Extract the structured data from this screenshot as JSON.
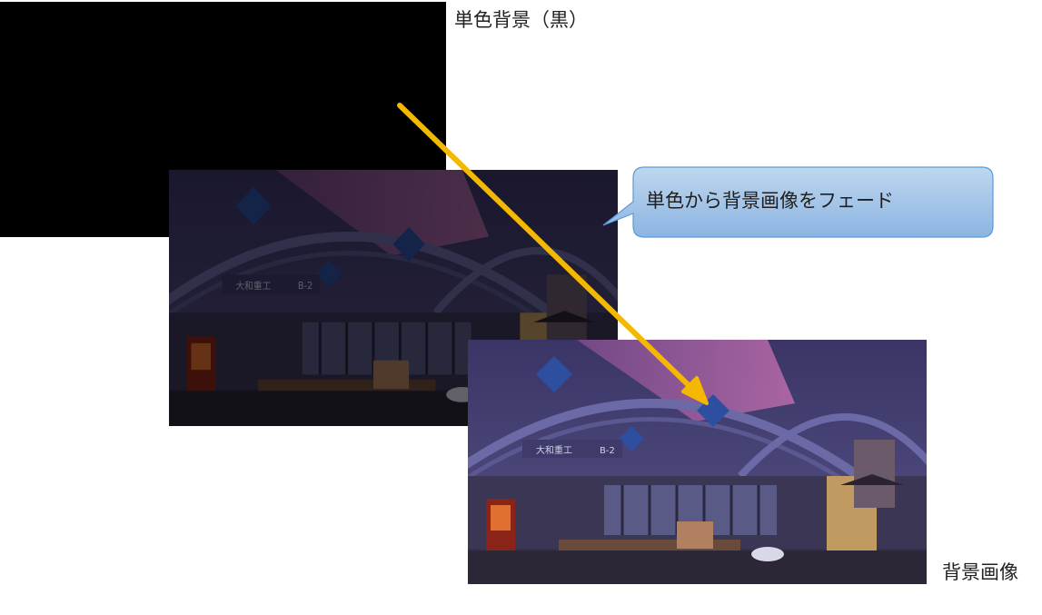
{
  "labels": {
    "solid_background": "単色背景（黒）",
    "background_image": "背景画像"
  },
  "callout": {
    "text": "単色から背景画像をフェード"
  },
  "colors": {
    "solid_background": "#000000",
    "arrow": "#f5b800",
    "callout_fill_top": "#bdd7ee",
    "callout_fill_bottom": "#8db4e2",
    "callout_stroke": "#5b9bd5"
  },
  "scene_sign": {
    "company": "大和重工",
    "block": "B-2"
  }
}
